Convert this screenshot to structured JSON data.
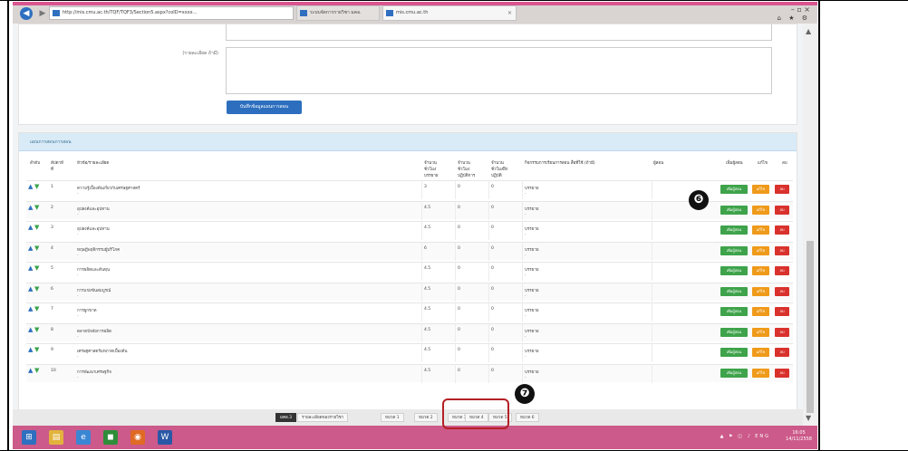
{
  "browser": {
    "url": "http://mis.cmu.ac.th/TQF/TQF3/Section5.aspx?coID=xxxx...",
    "tabs": [
      {
        "label": "ระบบจัดการรายวิชา มคอ."
      },
      {
        "label": "mis.cmu.ac.th"
      }
    ],
    "window_controls": "–  ▫  ×",
    "toolbar_icons": "⌂ ★ ⚙"
  },
  "form": {
    "note_label": "(รายละเอียด ถ้ามี)",
    "save_button": "บันทึกข้อมูลแผนการสอน"
  },
  "list": {
    "header": "แผนการสอนการสอน",
    "columns": {
      "order": "ลำดับ",
      "week": "สัปดาห์\nที่",
      "topic": "หัวข้อ/รายละเอียด",
      "lecture_hours": "จำนวน\nชั่วโมง\nบรรยาย",
      "lab_hours": "จำนวน\nชั่วโมง\nปฏิบัติการ",
      "self_hours": "จำนวน\nชั่วโมงฝึก\nปฏิบัติ",
      "activities": "กิจกรรมการเรียนการสอน สื่อที่ใช้ (ถ้ามี)",
      "instructor": "ผู้สอน",
      "add_instructor": "เพิ่มผู้สอน",
      "edit": "แก้ไข",
      "delete": "ลบ"
    },
    "rows": [
      {
        "week": "1",
        "topic": "ความรู้เบื้องต้นเกี่ยวกับเศรษฐศาสตร์",
        "lecture": "3",
        "lab": "0",
        "self": "0",
        "activity": "บรรยาย"
      },
      {
        "week": "2",
        "topic": "อุปสงค์และอุปทาน",
        "lecture": "4.5",
        "lab": "0",
        "self": "0",
        "activity": "บรรยาย"
      },
      {
        "week": "3",
        "topic": "อุปสงค์และอุปทาน",
        "lecture": "4.5",
        "lab": "0",
        "self": "0",
        "activity": "บรรยาย"
      },
      {
        "week": "4",
        "topic": "ทฤษฎีพฤติกรรมผู้บริโภค",
        "lecture": "6",
        "lab": "0",
        "self": "0",
        "activity": "บรรยาย"
      },
      {
        "week": "5",
        "topic": "การผลิตและต้นทุน",
        "lecture": "4.5",
        "lab": "0",
        "self": "0",
        "activity": "บรรยาย"
      },
      {
        "week": "6",
        "topic": "การแข่งขันสมบูรณ์",
        "lecture": "4.5",
        "lab": "0",
        "self": "0",
        "activity": "บรรยาย"
      },
      {
        "week": "7",
        "topic": "การผูกขาด",
        "lecture": "4.5",
        "lab": "0",
        "self": "0",
        "activity": "บรรยาย"
      },
      {
        "week": "8",
        "topic": "ตลาดปัจจัยการผลิต",
        "lecture": "4.5",
        "lab": "0",
        "self": "0",
        "activity": "บรรยาย"
      },
      {
        "week": "9",
        "topic": "เศรษฐศาสตร์มหภาคเบื้องต้น",
        "lecture": "4.5",
        "lab": "0",
        "self": "0",
        "activity": "บรรยาย"
      },
      {
        "week": "10",
        "topic": "การพัฒนาเศรษฐกิจ",
        "lecture": "4.5",
        "lab": "0",
        "self": "0",
        "activity": "บรรยาย"
      }
    ],
    "row_buttons": {
      "add": "เพิ่มผู้สอน",
      "edit": "แก้ไข",
      "delete": "ลบ"
    },
    "row_dash": "-"
  },
  "pager": {
    "badge": "มคอ.3",
    "items": [
      "รายละเอียดของรายวิชา",
      "หมวด 1",
      "หมวด 2",
      "หมวด 3",
      "หมวด 4",
      "หมวด 5",
      "หมวด 6"
    ]
  },
  "callouts": {
    "six": "❻",
    "seven": "❼"
  },
  "taskbar": {
    "tray": "▲ ⚑ ◫ ♪ ENG",
    "clock_time": "16:05",
    "clock_date": "14/11/2558"
  },
  "colors": {
    "accent": "#d8558f",
    "primary": "#2d6fbe",
    "add": "#3ea34a",
    "edit": "#ef9a1a",
    "delete": "#d9312c",
    "highlight": "#b52025"
  }
}
